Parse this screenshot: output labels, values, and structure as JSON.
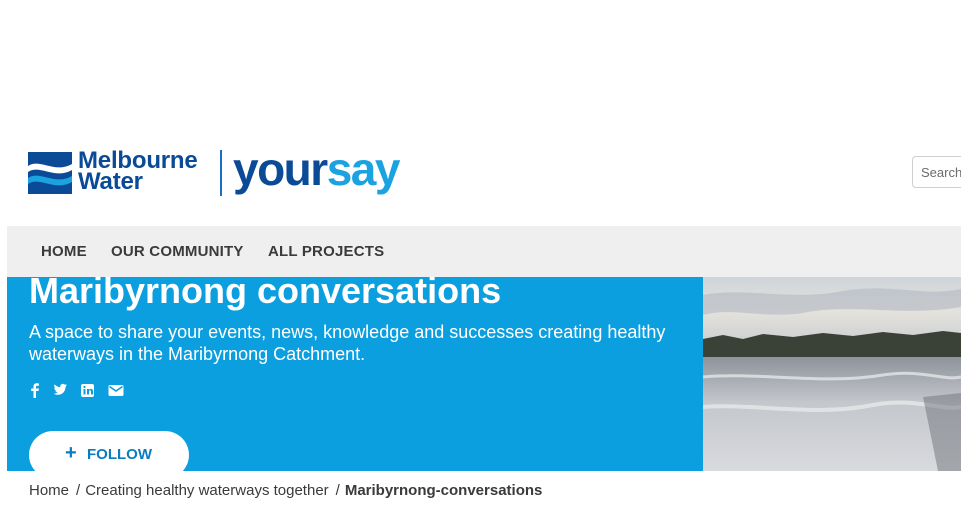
{
  "header": {
    "logo_melbourne": "Melbourne",
    "logo_water": "Water",
    "logo_your": "your",
    "logo_say": "say",
    "search_placeholder": "Search"
  },
  "nav": {
    "items": [
      {
        "label": "HOME"
      },
      {
        "label": "OUR COMMUNITY"
      },
      {
        "label": "ALL PROJECTS"
      }
    ]
  },
  "hero": {
    "title": "Maribyrnong conversations",
    "description": "A space to share your events, news, knowledge and successes creating healthy waterways in the Maribyrnong Catchment.",
    "social_icons": [
      "facebook-icon",
      "twitter-icon",
      "linkedin-icon",
      "email-icon"
    ],
    "follow_label": "FOLLOW",
    "background_color": "#0b9fe0"
  },
  "breadcrumb": {
    "items": [
      {
        "label": "Home"
      },
      {
        "label": "Creating healthy waterways together"
      },
      {
        "label": "Maribyrnong-conversations"
      }
    ],
    "separator": "/"
  }
}
